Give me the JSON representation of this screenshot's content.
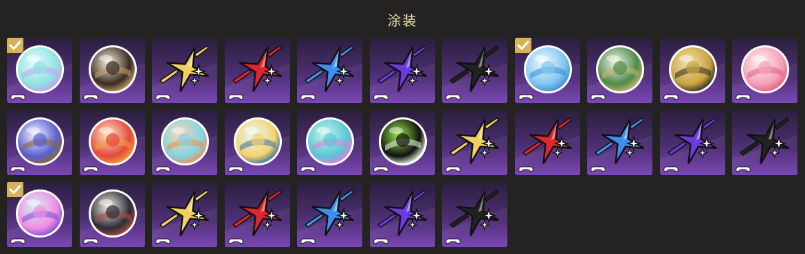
{
  "header": {
    "title": "涂装"
  },
  "accent": {
    "check": "#d7b25a",
    "tile_top": "#2b1f3d",
    "tile_bottom": "#7a47b4"
  },
  "tiles": [
    {
      "icon": "painted-orb-icon",
      "kind": "circle",
      "colors": [
        "#e6fbff",
        "#8fe3e0",
        "#c79af0"
      ],
      "selected": true
    },
    {
      "icon": "character-portrait-icon",
      "kind": "circle",
      "colors": [
        "#f7efd8",
        "#3a2a22",
        "#c7a06c"
      ],
      "selected": false
    },
    {
      "icon": "star-emblem-gold-icon",
      "kind": "star",
      "colors": [
        "#f1cf62"
      ],
      "selected": false
    },
    {
      "icon": "star-emblem-red-icon",
      "kind": "star",
      "colors": [
        "#e0262d"
      ],
      "selected": false
    },
    {
      "icon": "star-emblem-blue-icon",
      "kind": "star",
      "colors": [
        "#3f8df0"
      ],
      "selected": false
    },
    {
      "icon": "star-emblem-purple-icon",
      "kind": "star",
      "colors": [
        "#6a3be0"
      ],
      "selected": false
    },
    {
      "icon": "star-emblem-black-icon",
      "kind": "star",
      "colors": [
        "#222222"
      ],
      "selected": false
    },
    {
      "icon": "wave-orb-icon",
      "kind": "circle",
      "colors": [
        "#f4fbff",
        "#7fc6ef",
        "#3d8bd0"
      ],
      "selected": true
    },
    {
      "icon": "twin-creatures-icon",
      "kind": "circle",
      "colors": [
        "#eef3e6",
        "#4f8a4a",
        "#c9b46a"
      ],
      "selected": false
    },
    {
      "icon": "golden-compass-icon",
      "kind": "circle",
      "colors": [
        "#f3e3b0",
        "#c9a23f",
        "#2a2a2a"
      ],
      "selected": false
    },
    {
      "icon": "pink-portrait-icon",
      "kind": "circle",
      "colors": [
        "#fff0f3",
        "#f3a1b8",
        "#e05f82"
      ],
      "selected": false
    },
    {
      "icon": "crest-badge-icon",
      "kind": "circle",
      "colors": [
        "#f6f3ff",
        "#5a5fd0",
        "#8b6a2e"
      ],
      "selected": false
    },
    {
      "icon": "festival-mascots-icon",
      "kind": "circle",
      "colors": [
        "#ffe7c6",
        "#e24a3a",
        "#f4a13a"
      ],
      "selected": false
    },
    {
      "icon": "crystal-mask-icon",
      "kind": "circle",
      "colors": [
        "#ffd4b0",
        "#7fd6e6",
        "#f48c46"
      ],
      "selected": false
    },
    {
      "icon": "chibi-hero-icon",
      "kind": "circle",
      "colors": [
        "#eaf6ff",
        "#f3d36a",
        "#3a6ea8"
      ],
      "selected": false
    },
    {
      "icon": "pastel-swirl-icon",
      "kind": "circle",
      "colors": [
        "#c8f6e6",
        "#57c7d6",
        "#e77bd8"
      ],
      "selected": false
    },
    {
      "icon": "green-glitch-icon",
      "kind": "circle",
      "colors": [
        "#9be84a",
        "#101010",
        "#e8ffe0"
      ],
      "selected": false
    },
    {
      "icon": "star-emblem-gold-icon",
      "kind": "star",
      "colors": [
        "#f1cf62"
      ],
      "selected": false
    },
    {
      "icon": "star-emblem-red-icon",
      "kind": "star",
      "colors": [
        "#e0262d"
      ],
      "selected": false
    },
    {
      "icon": "star-emblem-blue-icon",
      "kind": "star",
      "colors": [
        "#3f8df0"
      ],
      "selected": false
    },
    {
      "icon": "star-emblem-purple-icon",
      "kind": "star",
      "colors": [
        "#6a3be0"
      ],
      "selected": false
    },
    {
      "icon": "star-emblem-black-icon",
      "kind": "star",
      "colors": [
        "#222222"
      ],
      "selected": false
    },
    {
      "icon": "pink-cat-icon",
      "kind": "circle",
      "colors": [
        "#cff4f3",
        "#f08ce2",
        "#7b4bd9"
      ],
      "selected": true
    },
    {
      "icon": "duo-portrait-icon",
      "kind": "circle",
      "colors": [
        "#f2ece6",
        "#2c2c34",
        "#b14a4a"
      ],
      "selected": false
    },
    {
      "icon": "star-emblem-gold-icon",
      "kind": "star",
      "colors": [
        "#f1cf62"
      ],
      "selected": false
    },
    {
      "icon": "star-emblem-red-icon",
      "kind": "star",
      "colors": [
        "#e0262d"
      ],
      "selected": false
    },
    {
      "icon": "star-emblem-blue-icon",
      "kind": "star",
      "colors": [
        "#3f8df0"
      ],
      "selected": false
    },
    {
      "icon": "star-emblem-purple-icon",
      "kind": "star",
      "colors": [
        "#6a3be0"
      ],
      "selected": false
    },
    {
      "icon": "star-emblem-black-icon",
      "kind": "star",
      "colors": [
        "#222222"
      ],
      "selected": false
    }
  ]
}
